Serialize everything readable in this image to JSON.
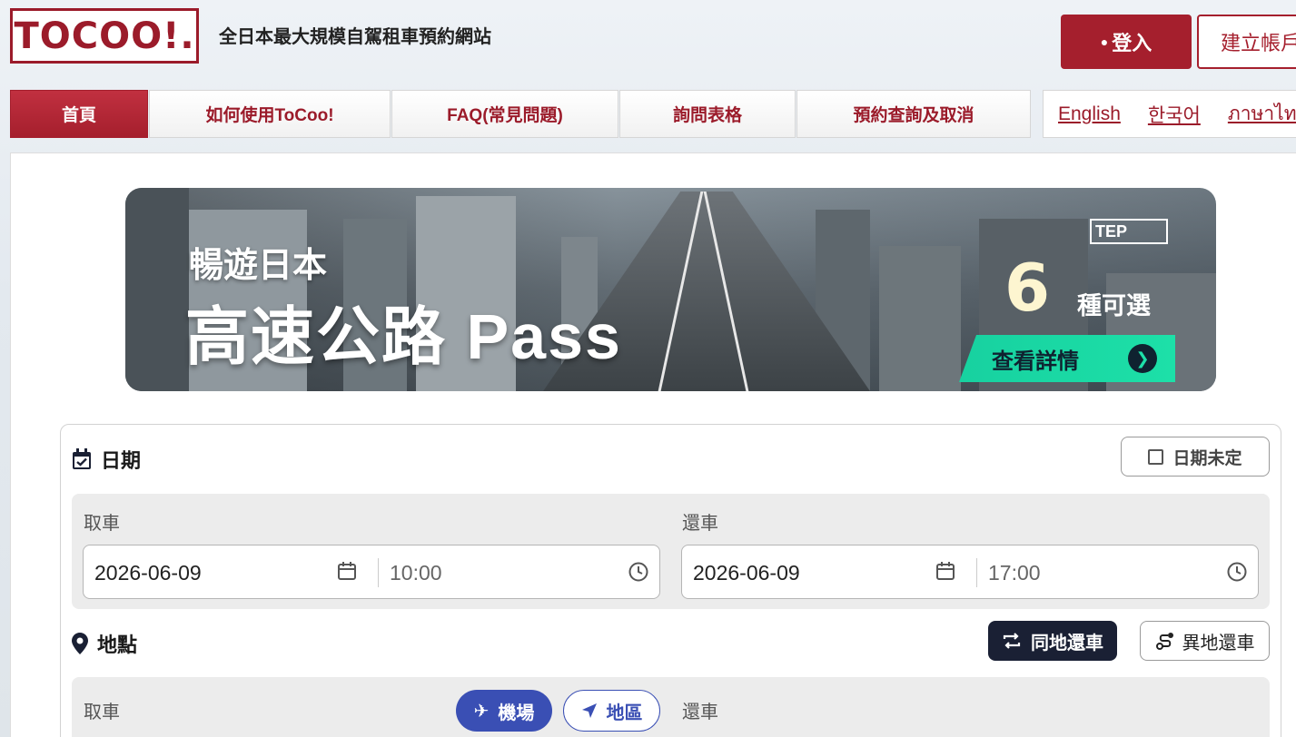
{
  "header": {
    "logo_text": "TOCOO!.",
    "tagline": "全日本最大規模自駕租車預約網站",
    "login_label": "登入",
    "register_label": "建立帳戶"
  },
  "nav": {
    "items": [
      {
        "label": "首頁",
        "active": true
      },
      {
        "label": "如何使用ToCoo!"
      },
      {
        "label": "FAQ(常見問題)"
      },
      {
        "label": "詢問表格"
      },
      {
        "label": "預約查詢及取消"
      }
    ],
    "languages": [
      "English",
      "한국어",
      "ภาษาไทย"
    ]
  },
  "banner": {
    "subtitle": "暢遊日本",
    "title": "高速公路 Pass",
    "badge": "TEP",
    "count": "6",
    "count_suffix": "種可選",
    "cta_label": "查看詳情"
  },
  "form": {
    "date_section_title": "日期",
    "date_undecided_label": "日期未定",
    "pickup_label": "取車",
    "return_label": "還車",
    "pickup_date": "2026-06-09",
    "pickup_time": "10:00",
    "return_date": "2026-06-09",
    "return_time": "17:00",
    "location_section_title": "地點",
    "same_location_label": "同地還車",
    "different_location_label": "異地還車",
    "location_pickup_label": "取車",
    "location_return_label": "還車",
    "airport_label": "機場",
    "region_label": "地區"
  },
  "colors": {
    "brand_red": "#a51f2d",
    "dark_navy": "#1a2034",
    "accent_blue": "#3a4fb4",
    "cta_green": "#1de0a8"
  }
}
